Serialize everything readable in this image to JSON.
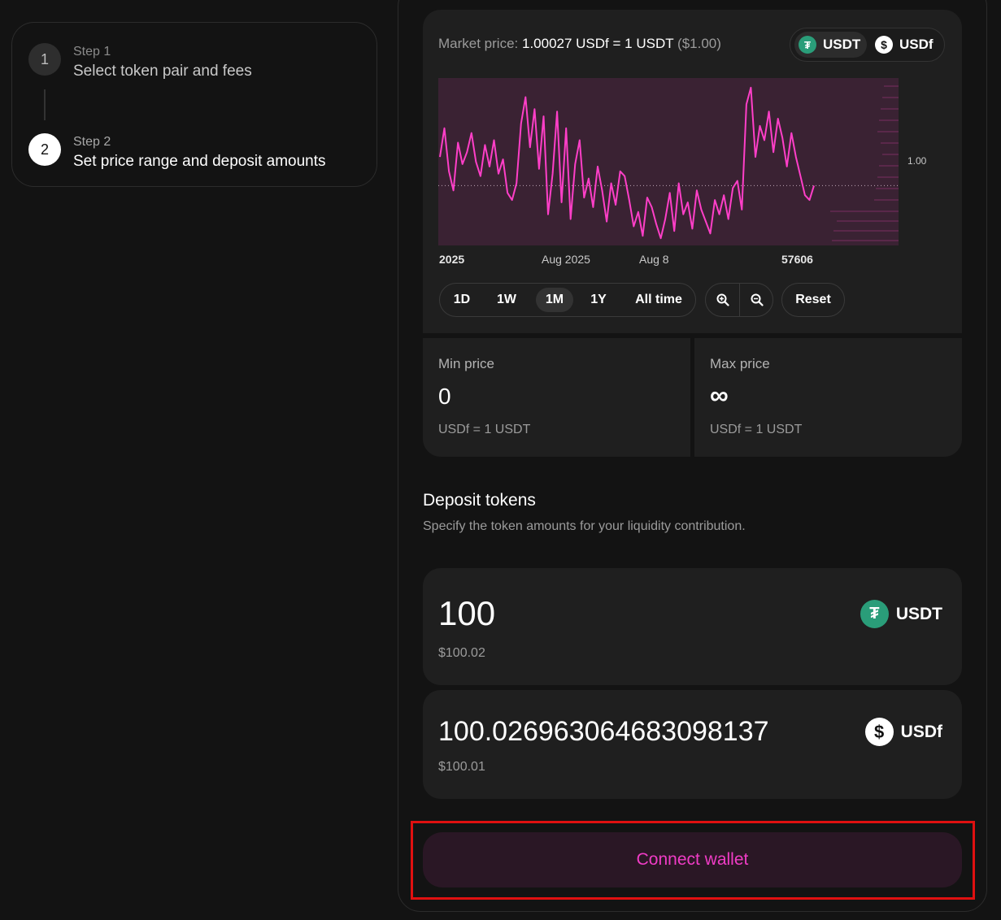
{
  "steps": [
    {
      "number": "1",
      "kicker": "Step 1",
      "title": "Select token pair and fees",
      "active": false
    },
    {
      "number": "2",
      "kicker": "Step 2",
      "title": "Set price range and deposit amounts",
      "active": true
    }
  ],
  "market": {
    "label": "Market price:",
    "rate": "1.00027 USDf = 1 USDT",
    "usd": "($1.00)"
  },
  "pair_toggle": {
    "options": [
      {
        "label": "USDT",
        "icon": "tether-icon",
        "selected": true
      },
      {
        "label": "USDf",
        "icon": "dollar-coin-icon",
        "selected": false
      }
    ]
  },
  "chart_data": {
    "type": "line",
    "title": "",
    "x_ticks": [
      "2025",
      "Aug 2025",
      "Aug 8",
      "57606"
    ],
    "y_ticks": [
      "1.00"
    ],
    "current_price": 1.0,
    "line_color": "#ff3fc8",
    "background_color": "#3a2233",
    "series": [
      {
        "values": [
          1.0012,
          1.0024,
          1.0006,
          0.9998,
          1.0018,
          1.0009,
          1.0014,
          1.0022,
          1.001,
          1.0004,
          1.0017,
          1.0008,
          1.0019,
          1.0005,
          1.0011,
          0.9997,
          0.9994,
          1.0001,
          1.0026,
          1.0037,
          1.0016,
          1.0032,
          1.0007,
          1.0029,
          0.9988,
          1.0005,
          1.0031,
          0.9993,
          1.0024,
          0.9986,
          1.0009,
          1.0019,
          0.9995,
          1.0003,
          0.9991,
          1.0008,
          0.9998,
          0.9985,
          1.0001,
          0.9992,
          1.0006,
          1.0004,
          0.9994,
          0.9983,
          0.9989,
          0.9979,
          0.9995,
          0.9991,
          0.9984,
          0.9978,
          0.9986,
          0.9997,
          0.9981,
          1.0001,
          0.9988,
          0.9993,
          0.9982,
          0.9998,
          0.999,
          0.9985,
          0.998,
          0.9994,
          0.9988,
          0.9996,
          0.9986,
          0.9999,
          1.0002,
          0.999,
          1.0034,
          1.0041,
          1.0012,
          1.0025,
          1.0019,
          1.0031,
          1.0014,
          1.0028,
          1.002,
          1.0008,
          1.0022,
          1.0012,
          1.0004,
          0.9996,
          0.9994,
          1.0
        ]
      }
    ]
  },
  "range_buttons": [
    {
      "label": "1D",
      "selected": false
    },
    {
      "label": "1W",
      "selected": false
    },
    {
      "label": "1M",
      "selected": true
    },
    {
      "label": "1Y",
      "selected": false
    },
    {
      "label": "All time",
      "selected": false
    }
  ],
  "reset_label": "Reset",
  "min_price": {
    "label": "Min price",
    "value": "0",
    "unit": "USDf = 1 USDT"
  },
  "max_price": {
    "label": "Max price",
    "value": "∞",
    "unit": "USDf = 1 USDT"
  },
  "deposit": {
    "title": "Deposit tokens",
    "subtitle": "Specify the token amounts for your liquidity contribution.",
    "token_a": {
      "amount": "100",
      "usd": "$100.02",
      "symbol": "USDT"
    },
    "token_b": {
      "amount": "100.026963064683098137",
      "usd": "$100.01",
      "symbol": "USDf"
    }
  },
  "connect_label": "Connect wallet",
  "colors": {
    "accent": "#f03cc6",
    "tether": "#2a9d79",
    "highlight_border": "#e01010"
  }
}
